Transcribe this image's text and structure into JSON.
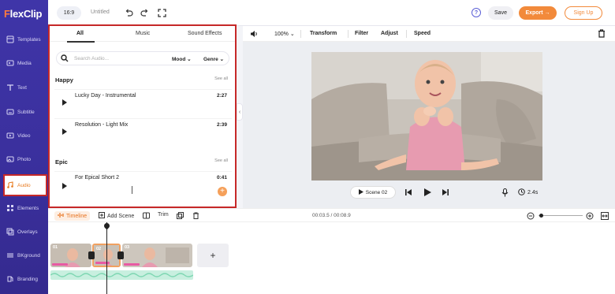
{
  "app": {
    "logo": "FlexClip"
  },
  "topbar": {
    "aspect_ratio": "16:9",
    "project_title": "Untitled",
    "save_label": "Save",
    "export_label": "Export →",
    "signup_label": "Sign Up"
  },
  "sidebar": {
    "items": [
      {
        "label": "Templates",
        "icon": "templates-icon"
      },
      {
        "label": "Media",
        "icon": "media-icon"
      },
      {
        "label": "Text",
        "icon": "text-icon"
      },
      {
        "label": "Subtitle",
        "icon": "subtitle-icon"
      },
      {
        "label": "Video",
        "icon": "video-icon"
      },
      {
        "label": "Photo",
        "icon": "photo-icon"
      },
      {
        "label": "Audio",
        "icon": "audio-icon",
        "active": true
      },
      {
        "label": "Elements",
        "icon": "elements-icon"
      },
      {
        "label": "Overlays",
        "icon": "overlays-icon"
      },
      {
        "label": "BKground",
        "icon": "background-icon"
      },
      {
        "label": "Branding",
        "icon": "branding-icon"
      }
    ]
  },
  "audio_panel": {
    "tabs": [
      "All",
      "Music",
      "Sound Effects"
    ],
    "active_tab": "All",
    "search_placeholder": "Search Audio...",
    "filter_mood": "Mood",
    "filter_genre": "Genre",
    "sections": [
      {
        "title": "Happy",
        "see_all": "See all",
        "tracks": [
          {
            "name": "Lucky Day - Instrumental",
            "duration": "2:27"
          },
          {
            "name": "Resolution - Light Mix",
            "duration": "2:39"
          }
        ]
      },
      {
        "title": "Epic",
        "see_all": "See all",
        "tracks": [
          {
            "name": "For Epical Short 2",
            "duration": "0:41"
          }
        ]
      }
    ]
  },
  "edit_toolbar": {
    "zoom": "100%",
    "items": [
      "Transform",
      "Filter",
      "Adjust",
      "Speed"
    ]
  },
  "player": {
    "scene_label": "Scene 02",
    "duration": "2.4s"
  },
  "timeline": {
    "timeline_label": "Timeline",
    "add_scene_label": "Add Scene",
    "trim_label": "Trim",
    "timecode": "00:03.5 / 00:08.9",
    "zoom_level": 0.05,
    "clips": [
      {
        "label": "01"
      },
      {
        "label": "02"
      },
      {
        "label": "03"
      }
    ]
  },
  "colors": {
    "sidebar": "#3f35a8",
    "accent": "#f28a3b",
    "highlight_border": "#c62828",
    "audio_track": "#c8efdf"
  }
}
